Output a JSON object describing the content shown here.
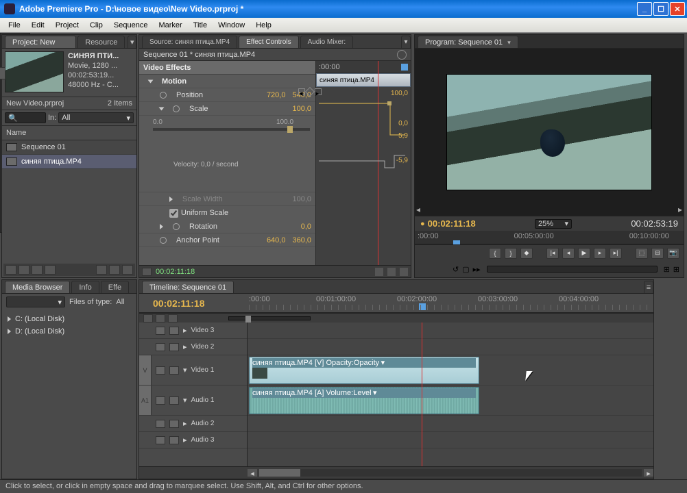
{
  "window": {
    "title": "Adobe Premiere Pro - D:\\новое видео\\New Video.prproj *"
  },
  "menu": [
    "File",
    "Edit",
    "Project",
    "Clip",
    "Sequence",
    "Marker",
    "Title",
    "Window",
    "Help"
  ],
  "project": {
    "tab": "Project: New Video",
    "tab2": "Resource",
    "clipName": "СИНЯЯ ПТИ...",
    "meta1": "Movie, 1280 ...",
    "meta2": "00:02:53:19...",
    "meta3": "48000 Hz - C...",
    "binName": "New Video.prproj",
    "itemCount": "2 Items",
    "inLabel": "In:",
    "inValue": "All",
    "headerName": "Name",
    "items": [
      "Sequence 01",
      "синяя птица.MP4"
    ]
  },
  "effect": {
    "tabs": [
      "Source: синяя птица.MP4",
      "Effect Controls",
      "Audio Mixer:"
    ],
    "header": "Sequence 01 * синяя птица.MP4",
    "section": "Video Effects",
    "clipTag": "синяя птица.MP4",
    "timeHead": ":00:00",
    "motion": {
      "label": "Motion",
      "position": {
        "label": "Position",
        "x": "720,0",
        "y": "540,0"
      },
      "scale": {
        "label": "Scale",
        "v": "100,0",
        "hi": "100.0",
        "lo": "0.0",
        "val100": "100,0",
        "val0": "0,0",
        "p1": "5,9",
        "n1": "-5,9",
        "vel": "Velocity: 0,0 / second"
      },
      "scaleWidth": {
        "label": "Scale Width",
        "v": "100,0"
      },
      "uniform": "Uniform Scale",
      "rotation": {
        "label": "Rotation",
        "v": "0,0"
      },
      "anchor": {
        "label": "Anchor Point",
        "x": "640,0",
        "y": "360,0"
      }
    },
    "statusTC": "00:02:11:18"
  },
  "program": {
    "tab": "Program: Sequence 01",
    "cur": "00:02:11:18",
    "zoom": "25%",
    "dur": "00:02:53:19",
    "ruler": [
      ":00:00",
      "00:05:00:00",
      "00:10:00:00"
    ]
  },
  "mediaBrowser": {
    "tabs": [
      "Media Browser",
      "Info",
      "Effe"
    ],
    "filesLabel": "Files of type:",
    "filesValue": "All",
    "drives": [
      "C: (Local Disk)",
      "D: (Local Disk)"
    ]
  },
  "timeline": {
    "tab": "Timeline: Sequence 01",
    "tc": "00:02:11:18",
    "ruler": [
      ":00:00",
      "00:01:00:00",
      "00:02:00:00",
      "00:03:00:00",
      "00:04:00:00"
    ],
    "tracks": {
      "v3": "Video 3",
      "v2": "Video 2",
      "v1": "Video 1",
      "a1": "Audio 1",
      "a2": "Audio 2",
      "a3": "Audio 3",
      "tV": "V",
      "tA": "A1"
    },
    "clipV": "синяя птица.MP4 [V]  Opacity:Opacity",
    "clipA": "синяя птица.MP4 [A]  Volume:Level"
  },
  "status": "Click to select, or click in empty space and drag to marquee select. Use Shift, Alt, and Ctrl for other options."
}
